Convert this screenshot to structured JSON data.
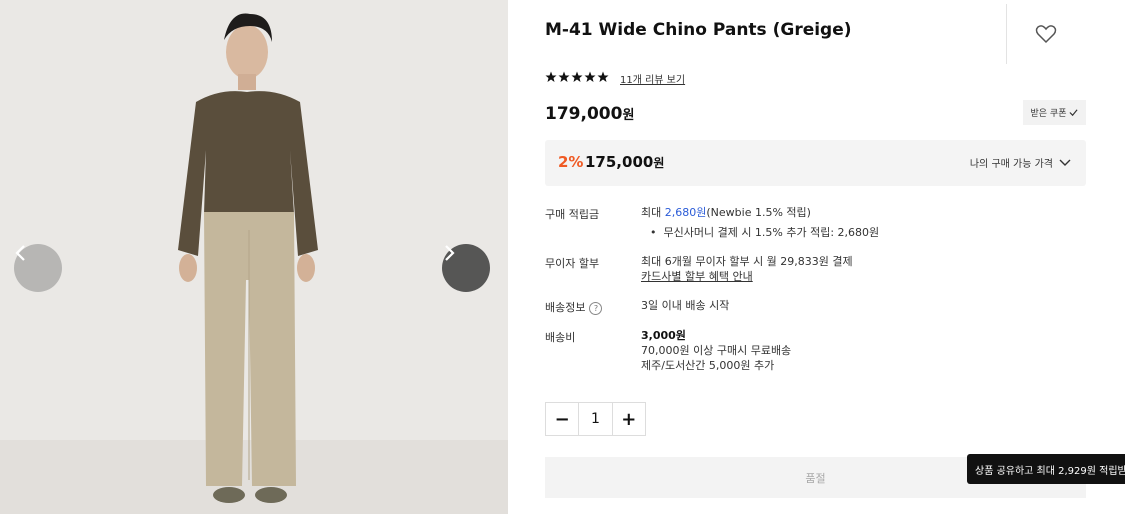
{
  "product": {
    "title": "M-41 Wide Chino Pants (Greige)",
    "rating_stars": 5,
    "review_link": "11개 리뷰 보기",
    "price": "179,000",
    "price_unit": "원",
    "coupon_button": "받은 쿠폰"
  },
  "buy_price": {
    "discount": "2%",
    "amount": "175,000",
    "unit": "원",
    "my_price_toggle": "나의 구매 가능 가격"
  },
  "info": {
    "points_label": "구매 적립금",
    "points_prefix": "최대",
    "points_amount": "2,680원",
    "points_suffix": "(Newbie 1.5% 적립)",
    "points_bullet": "무신사머니 결제 시 1.5% 추가 적립: 2,680원",
    "installment_label": "무이자 할부",
    "installment_text": "최대 6개월 무이자 할부 시 월 29,833원 결제",
    "installment_link": "카드사별 할부 혜택 안내",
    "shipping_label": "배송정보",
    "shipping_text": "3일 이내 배송 시작",
    "fee_label": "배송비",
    "fee_amount": "3,000원",
    "fee_free": "70,000원 이상 구매시 무료배송",
    "fee_island": "제주/도서산간 5,000원 추가"
  },
  "quantity": {
    "value": "1",
    "minus": "−",
    "plus": "+"
  },
  "soldout_button": "품절",
  "share_tooltip": "상품 공유하고 최대 2,929원 적립받",
  "colors": {
    "accent_orange": "#f05a24",
    "link_blue": "#2a5bd7"
  },
  "icons": [
    "chevron-left-icon",
    "chevron-right-icon",
    "heart-icon",
    "star-icon",
    "check-icon",
    "chevron-down-icon",
    "help-icon"
  ]
}
